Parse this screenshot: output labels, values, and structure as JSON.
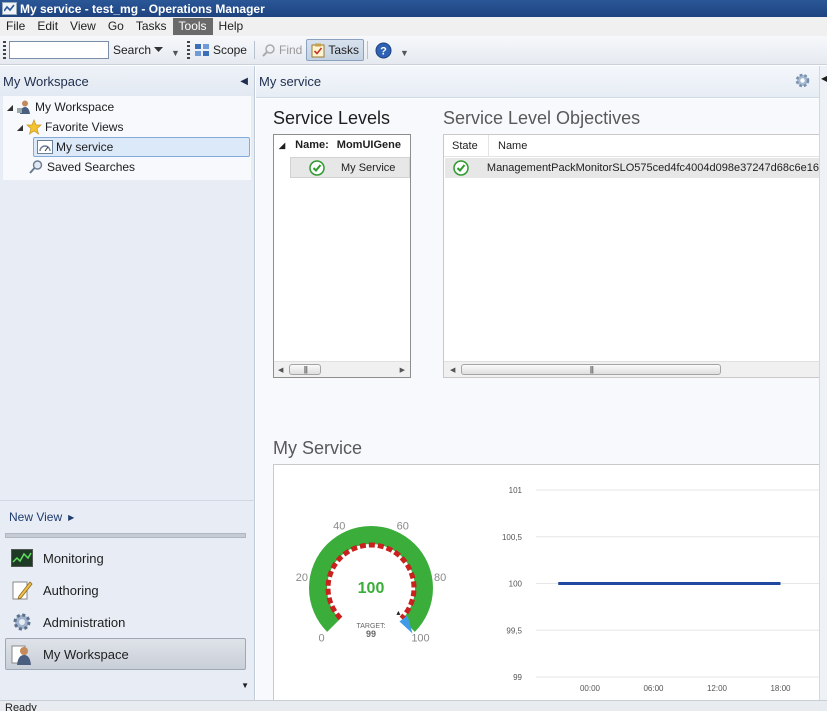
{
  "window": {
    "title": "My service - test_mg - Operations Manager"
  },
  "menu": [
    "File",
    "Edit",
    "View",
    "Go",
    "Tasks",
    "Tools",
    "Help"
  ],
  "menu_active": "Tools",
  "toolbar": {
    "search_value": "",
    "search_label": "Search",
    "scope_label": "Scope",
    "find_label": "Find",
    "tasks_label": "Tasks"
  },
  "left": {
    "header": "My Workspace",
    "tree": {
      "root": "My Workspace",
      "favorite_views": "Favorite Views",
      "my_service": "My service",
      "saved_searches": "Saved Searches"
    },
    "new_view": "New View",
    "wunderbar": {
      "monitoring": "Monitoring",
      "authoring": "Authoring",
      "administration": "Administration",
      "my_workspace": "My Workspace"
    }
  },
  "main": {
    "header": "My service",
    "service_levels": {
      "title": "Service Levels",
      "name_label": "Name:",
      "name_value": "MomUIGene",
      "row": "My Service"
    },
    "slo": {
      "title": "Service Level Objectives",
      "col_state": "State",
      "col_name": "Name",
      "row_name": "ManagementPackMonitorSLO575ced4fc4004d098e37247d68c6e16"
    },
    "my_service": {
      "title": "My Service",
      "gauge": {
        "value": 100,
        "target_label": "TARGET:",
        "target_value": "99",
        "scale_labels": [
          "0",
          "20",
          "40",
          "60",
          "80",
          "100"
        ]
      }
    }
  },
  "status": {
    "text": "Ready"
  },
  "colors": {
    "accent": "#2b5797",
    "gauge_green": "#3aad3a",
    "gauge_red": "#c9211e",
    "line": "#2247a0"
  },
  "chart_data": {
    "type": "line",
    "title": "",
    "xlabel": "",
    "ylabel": "",
    "x_ticks": [
      "00:00",
      "06:00",
      "12:00",
      "18:00"
    ],
    "y_ticks": [
      "101",
      "100,5",
      "100",
      "99,5",
      "99"
    ],
    "ylim": [
      99,
      101
    ],
    "grid": true,
    "series": [
      {
        "x": [
          "-03:00",
          "18:00"
        ],
        "values": [
          100,
          100
        ]
      }
    ]
  }
}
